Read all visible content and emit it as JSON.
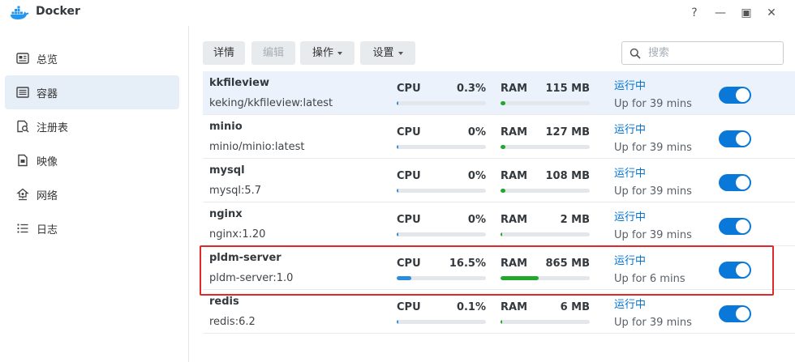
{
  "window": {
    "title": "Docker"
  },
  "window_controls": [
    "?",
    "—",
    "▣",
    "✕"
  ],
  "sidebar": {
    "items": [
      {
        "label": "总览",
        "icon": "overview-icon"
      },
      {
        "label": "容器",
        "icon": "container-icon",
        "active": true
      },
      {
        "label": "注册表",
        "icon": "registry-icon"
      },
      {
        "label": "映像",
        "icon": "image-icon"
      },
      {
        "label": "网络",
        "icon": "network-icon"
      },
      {
        "label": "日志",
        "icon": "log-icon"
      }
    ]
  },
  "toolbar": {
    "details_label": "详情",
    "edit_label": "编辑",
    "action_label": "操作",
    "settings_label": "设置",
    "search_placeholder": "搜索"
  },
  "containers": [
    {
      "name": "kkfileview",
      "image": "keking/kkfileview:latest",
      "cpu_label": "CPU",
      "cpu": "0.3%",
      "cpu_fraction": 0.003,
      "ram_label": "RAM",
      "ram": "115 MB",
      "ram_fraction": 0.05,
      "status": "运行中",
      "uptime": "Up for 39 mins",
      "running": true
    },
    {
      "name": "minio",
      "image": "minio/minio:latest",
      "cpu_label": "CPU",
      "cpu": "0%",
      "cpu_fraction": 0,
      "ram_label": "RAM",
      "ram": "127 MB",
      "ram_fraction": 0.05,
      "status": "运行中",
      "uptime": "Up for 39 mins",
      "running": true
    },
    {
      "name": "mysql",
      "image": "mysql:5.7",
      "cpu_label": "CPU",
      "cpu": "0%",
      "cpu_fraction": 0,
      "ram_label": "RAM",
      "ram": "108 MB",
      "ram_fraction": 0.05,
      "status": "运行中",
      "uptime": "Up for 39 mins",
      "running": true
    },
    {
      "name": "nginx",
      "image": "nginx:1.20",
      "cpu_label": "CPU",
      "cpu": "0%",
      "cpu_fraction": 0,
      "ram_label": "RAM",
      "ram": "2 MB",
      "ram_fraction": 0.005,
      "status": "运行中",
      "uptime": "Up for 39 mins",
      "running": true
    },
    {
      "name": "pldm-server",
      "image": "pldm-server:1.0",
      "cpu_label": "CPU",
      "cpu": "16.5%",
      "cpu_fraction": 0.165,
      "ram_label": "RAM",
      "ram": "865 MB",
      "ram_fraction": 0.43,
      "status": "运行中",
      "uptime": "Up for 6 mins",
      "running": true
    },
    {
      "name": "redis",
      "image": "redis:6.2",
      "cpu_label": "CPU",
      "cpu": "0.1%",
      "cpu_fraction": 0.001,
      "ram_label": "RAM",
      "ram": "6 MB",
      "ram_fraction": 0.005,
      "status": "运行中",
      "uptime": "Up for 39 mins",
      "running": true
    }
  ],
  "colors": {
    "accent": "#0a78d8",
    "cpu_bar": "#2b8bdc",
    "ram_bar": "#1fa82c",
    "highlight": "#e02a2a",
    "status": "#0073d2"
  }
}
